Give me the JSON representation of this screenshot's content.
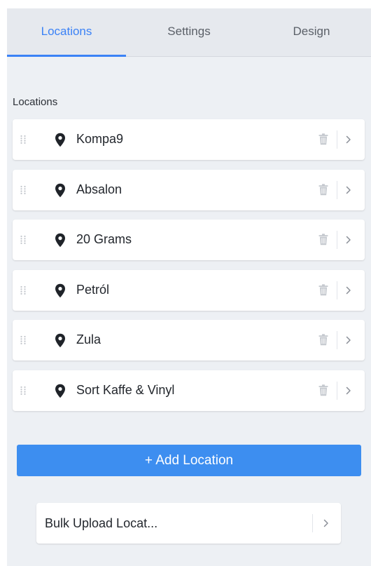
{
  "tabs": [
    {
      "label": "Locations",
      "active": true
    },
    {
      "label": "Settings",
      "active": false
    },
    {
      "label": "Design",
      "active": false
    }
  ],
  "section": {
    "label": "Locations"
  },
  "locations": [
    {
      "name": "Kompa9"
    },
    {
      "name": "Absalon"
    },
    {
      "name": "20 Grams"
    },
    {
      "name": "Petról"
    },
    {
      "name": "Zula"
    },
    {
      "name": "Sort Kaffe & Vinyl"
    }
  ],
  "icons": {
    "drag": "drag-handle-icon",
    "pin": "map-pin-icon",
    "delete": "trash-icon",
    "open": "chevron-right-icon"
  },
  "add_button": {
    "label": "+ Add Location"
  },
  "bulk_upload": {
    "label": "Bulk Upload Locat..."
  },
  "colors": {
    "accent": "#3b82f6",
    "button": "#3d8ef0",
    "panel_bg": "#edf0f4",
    "tab_bg": "#e6e9ee"
  }
}
